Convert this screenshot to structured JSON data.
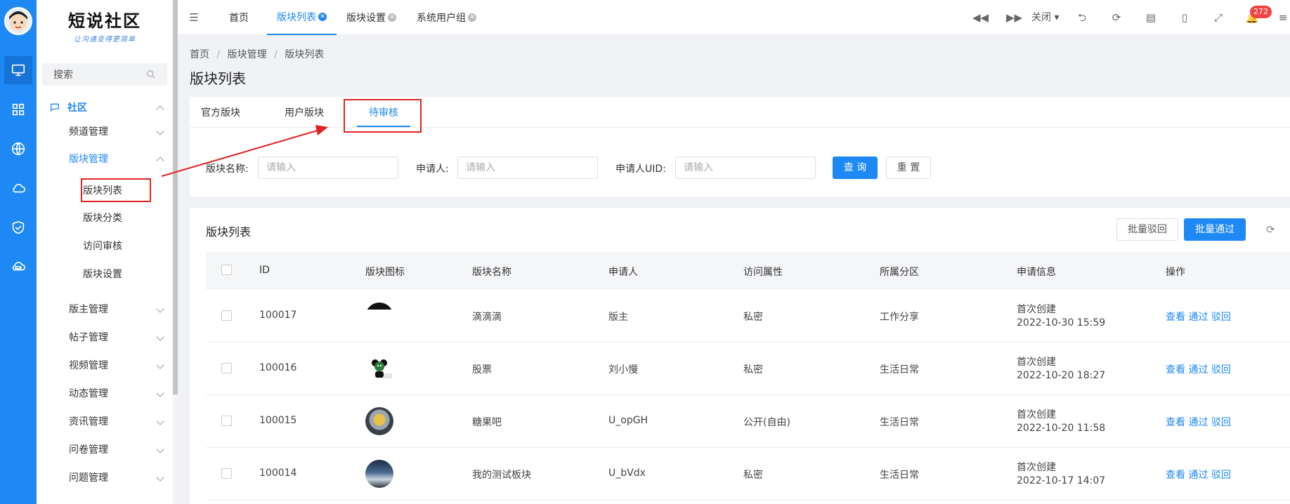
{
  "sidebar": {
    "logo_title": "短说社区",
    "logo_subtitle": "让沟通变得更简单",
    "search_placeholder": "搜索",
    "group_label": "社区",
    "items": [
      {
        "label": "频道管理"
      },
      {
        "label": "版块管理"
      },
      {
        "label": "版块列表"
      },
      {
        "label": "版块分类"
      },
      {
        "label": "访问审核"
      },
      {
        "label": "版块设置"
      },
      {
        "label": "版主管理"
      },
      {
        "label": "帖子管理"
      },
      {
        "label": "视频管理"
      },
      {
        "label": "动态管理"
      },
      {
        "label": "资讯管理"
      },
      {
        "label": "问卷管理"
      },
      {
        "label": "问题管理"
      }
    ]
  },
  "topbar": {
    "tabs": [
      "首页",
      "版块列表",
      "版块设置",
      "系统用户组"
    ],
    "close_label": "关闭",
    "notification_count": "272"
  },
  "breadcrumb": [
    "首页",
    "版块管理",
    "版块列表"
  ],
  "page_title": "版块列表",
  "subtabs": [
    "官方版块",
    "用户版块",
    "待审核"
  ],
  "filters": {
    "name_label": "版块名称:",
    "applicant_label": "申请人:",
    "uid_label": "申请人UID:",
    "placeholder": "请输入",
    "query_btn": "查 询",
    "reset_btn": "重 置"
  },
  "table": {
    "title": "版块列表",
    "batch_reject": "批量驳回",
    "batch_pass": "批量通过",
    "columns": [
      "ID",
      "版块图标",
      "版块名称",
      "申请人",
      "访问属性",
      "所属分区",
      "申请信息",
      "操作"
    ],
    "rows": [
      {
        "id": "100017",
        "name": "滴滴滴",
        "applicant": "版主",
        "access": "私密",
        "zone": "工作分享",
        "info_label": "首次创建",
        "info_time": "2022-10-30 15:59"
      },
      {
        "id": "100016",
        "name": "股票",
        "applicant": "刘小慢",
        "access": "私密",
        "zone": "生活日常",
        "info_label": "首次创建",
        "info_time": "2022-10-20 18:27"
      },
      {
        "id": "100015",
        "name": "糖果吧",
        "applicant": "U_opGH",
        "access": "公开(自由)",
        "zone": "生活日常",
        "info_label": "首次创建",
        "info_time": "2022-10-20 11:58"
      },
      {
        "id": "100014",
        "name": "我的测试板块",
        "applicant": "U_bVdx",
        "access": "私密",
        "zone": "生活日常",
        "info_label": "首次创建",
        "info_time": "2022-10-17 14:07"
      }
    ],
    "ops": {
      "view": "查看",
      "pass": "通过",
      "reject": "驳回"
    }
  },
  "colors": {
    "accent": "#1e88f5",
    "highlight": "#e02424"
  }
}
